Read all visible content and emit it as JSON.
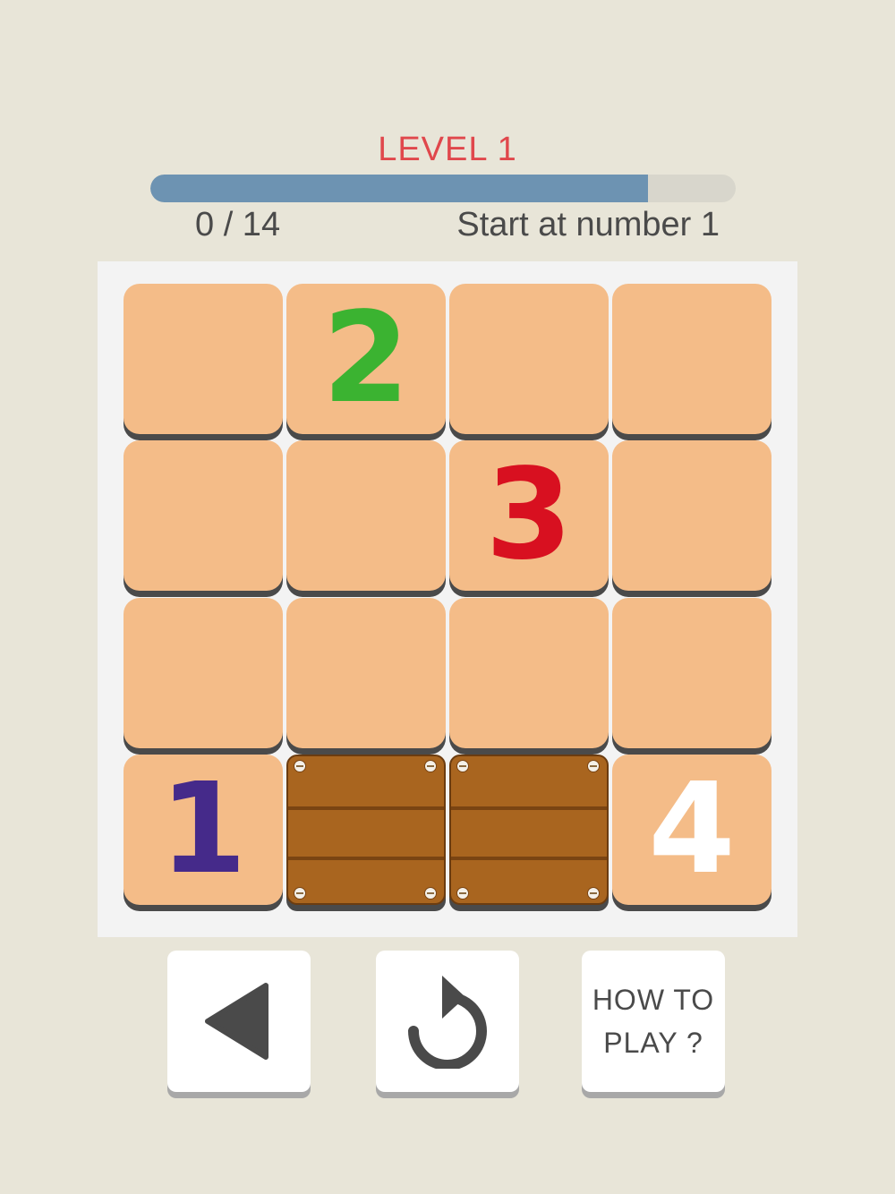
{
  "header": {
    "level_title": "LEVEL 1",
    "progress": 0.85,
    "moves": "0 / 14",
    "hint": "Start at number 1"
  },
  "board": {
    "tiles": [
      {
        "row": 0,
        "col": 0,
        "type": "empty",
        "label": ""
      },
      {
        "row": 0,
        "col": 1,
        "type": "number",
        "label": "2",
        "color": "#3bb331"
      },
      {
        "row": 0,
        "col": 2,
        "type": "empty",
        "label": ""
      },
      {
        "row": 0,
        "col": 3,
        "type": "empty",
        "label": ""
      },
      {
        "row": 1,
        "col": 0,
        "type": "empty",
        "label": ""
      },
      {
        "row": 1,
        "col": 1,
        "type": "empty",
        "label": ""
      },
      {
        "row": 1,
        "col": 2,
        "type": "number",
        "label": "3",
        "color": "#d81020"
      },
      {
        "row": 1,
        "col": 3,
        "type": "empty",
        "label": ""
      },
      {
        "row": 2,
        "col": 0,
        "type": "empty",
        "label": ""
      },
      {
        "row": 2,
        "col": 1,
        "type": "empty",
        "label": ""
      },
      {
        "row": 2,
        "col": 2,
        "type": "empty",
        "label": ""
      },
      {
        "row": 2,
        "col": 3,
        "type": "empty",
        "label": ""
      },
      {
        "row": 3,
        "col": 0,
        "type": "number",
        "label": "1",
        "color": "#452a8a"
      },
      {
        "row": 3,
        "col": 1,
        "type": "wood",
        "label": ""
      },
      {
        "row": 3,
        "col": 2,
        "type": "wood",
        "label": ""
      },
      {
        "row": 3,
        "col": 3,
        "type": "number",
        "label": "4",
        "color": "#ffffff"
      }
    ]
  },
  "controls": {
    "back_icon": "triangle-left-icon",
    "restart_icon": "restart-icon",
    "how_to_line1": "HOW TO",
    "how_to_line2": "PLAY ?"
  }
}
